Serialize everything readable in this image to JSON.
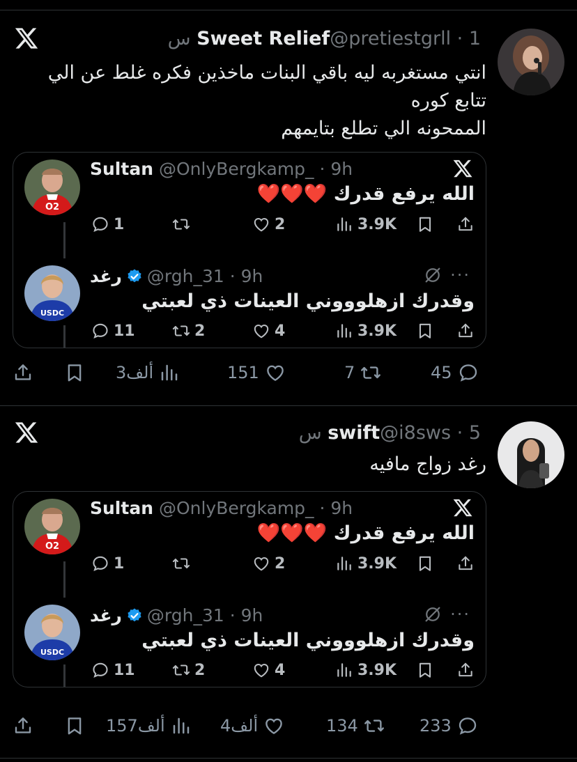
{
  "tweets": [
    {
      "name": "Sweet Relief",
      "meta": "@pretiestgrll · 1 س",
      "lines": [
        "انتي مستغربه ليه باقي البنات ماخذين فكره غلط عن الي",
        "تتابع كوره",
        "الممحونه الي تطلع بتايمهم"
      ],
      "actions": {
        "replies": "45",
        "reposts": "7",
        "likes": "151",
        "views": "3ألف"
      },
      "quote": {
        "top": {
          "name": "Sultan",
          "meta": "@OnlyBergkamp_ · 9h",
          "text": "الله يرفع قدرك",
          "hearts": "❤️❤️❤️",
          "replies": "1",
          "reposts": "",
          "likes": "2",
          "views": "3.9K"
        },
        "reply": {
          "name": "رغد",
          "meta": "@rgh_31 · 9h",
          "text": "وقدرك ازهلوووني العينات ذي لعبتي",
          "replies": "11",
          "reposts": "2",
          "likes": "4",
          "views": "3.9K",
          "more": "···"
        }
      }
    },
    {
      "name": "swift",
      "meta": "@i8sws · 5 س",
      "lines": [
        "رغد زواج مافيه"
      ],
      "actions": {
        "replies": "233",
        "reposts": "134",
        "likes": "4ألف",
        "views": "157ألف"
      },
      "quote": {
        "top": {
          "name": "Sultan",
          "meta": "@OnlyBergkamp_ · 9h",
          "text": "الله يرفع قدرك",
          "hearts": "❤️❤️❤️",
          "replies": "1",
          "reposts": "",
          "likes": "2",
          "views": "3.9K"
        },
        "reply": {
          "name": "رغد",
          "meta": "@rgh_31 · 9h",
          "text": "وقدرك ازهلوووني العينات ذي لعبتي",
          "replies": "11",
          "reposts": "2",
          "likes": "4",
          "views": "3.9K",
          "more": "···"
        }
      }
    }
  ],
  "colors": {
    "background": "#000000",
    "text": "#e7e9ea",
    "secondary": "#71767b",
    "verified": "#1d9bf0",
    "heart": "#e0245e",
    "border": "#2f3336"
  },
  "icons": [
    "x-logo-icon",
    "reply-icon",
    "repost-icon",
    "like-icon",
    "views-icon",
    "bookmark-icon",
    "share-icon",
    "verified-icon",
    "mute-icon"
  ]
}
